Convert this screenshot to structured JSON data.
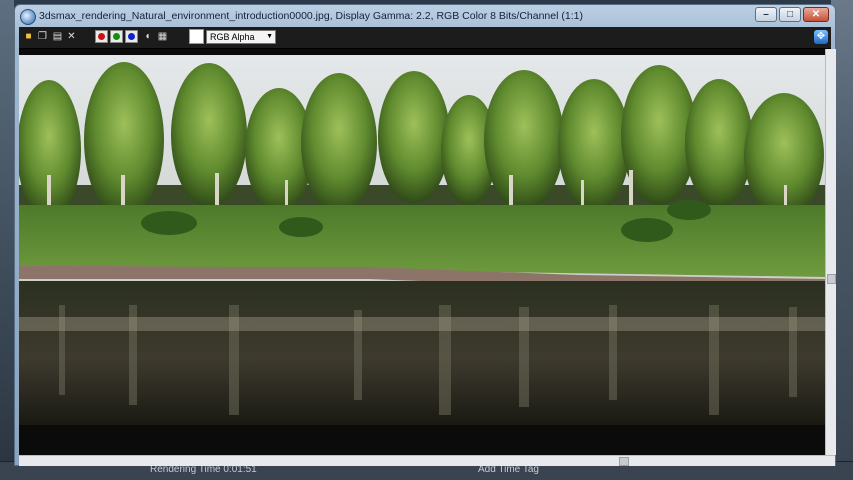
{
  "window": {
    "title": "3dsmax_rendering_Natural_environment_introduction0000.jpg, Display Gamma: 2.2, RGB Color 8 Bits/Channel (1:1)",
    "buttons": {
      "minimize": "–",
      "maximize": "□",
      "close": "✕"
    }
  },
  "toolbar": {
    "icons": [
      "save-icon",
      "copy-icon",
      "print-icon",
      "clear-icon"
    ],
    "channels": [
      {
        "name": "red-channel",
        "color": "#d01010"
      },
      {
        "name": "green-channel",
        "color": "#109010"
      },
      {
        "name": "blue-channel",
        "color": "#1020d0"
      }
    ],
    "channel_select": "RGB Alpha"
  },
  "background_status": {
    "rendering_time": "Rendering Time 0:01:51",
    "add_time_tag": "Add Time Tag"
  },
  "colors": {
    "sky": "#d9dde0",
    "grass": "#5a8a32",
    "water": "#1a1e14",
    "accent": "#1f67c9"
  }
}
